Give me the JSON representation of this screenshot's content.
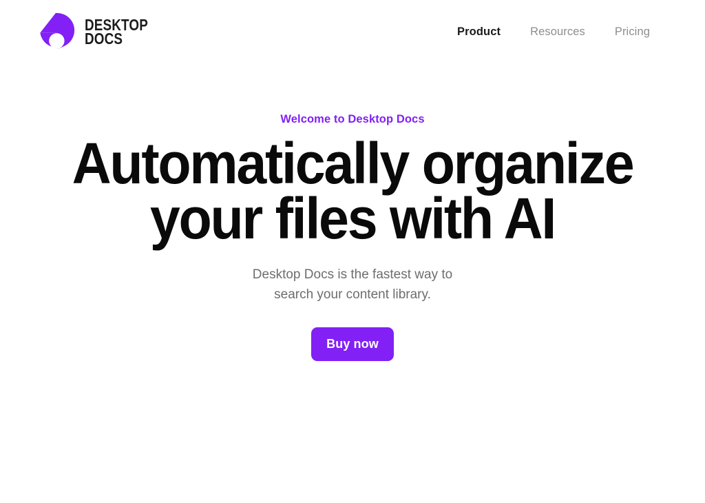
{
  "theme": {
    "background": "#ffffff",
    "accent": "#8220f5",
    "heading_color": "#0a0a0a",
    "muted_text": "#6d6d6d",
    "nav_muted": "#8d8d8d"
  },
  "header": {
    "brand": {
      "logo_icon": "desktop-docs-logo-icon",
      "wordmark_line1": "DESKTOP",
      "wordmark_line2": "DOCS"
    },
    "nav": [
      {
        "label": "Product",
        "active": true
      },
      {
        "label": "Resources",
        "active": false
      },
      {
        "label": "Pricing",
        "active": false
      }
    ]
  },
  "hero": {
    "eyebrow": "Welcome to Desktop Docs",
    "title_line1": "Automatically organize",
    "title_line2": "your files with AI",
    "subtitle_line1": "Desktop Docs is the fastest way to",
    "subtitle_line2": "search your content library.",
    "cta_label": "Buy now"
  }
}
